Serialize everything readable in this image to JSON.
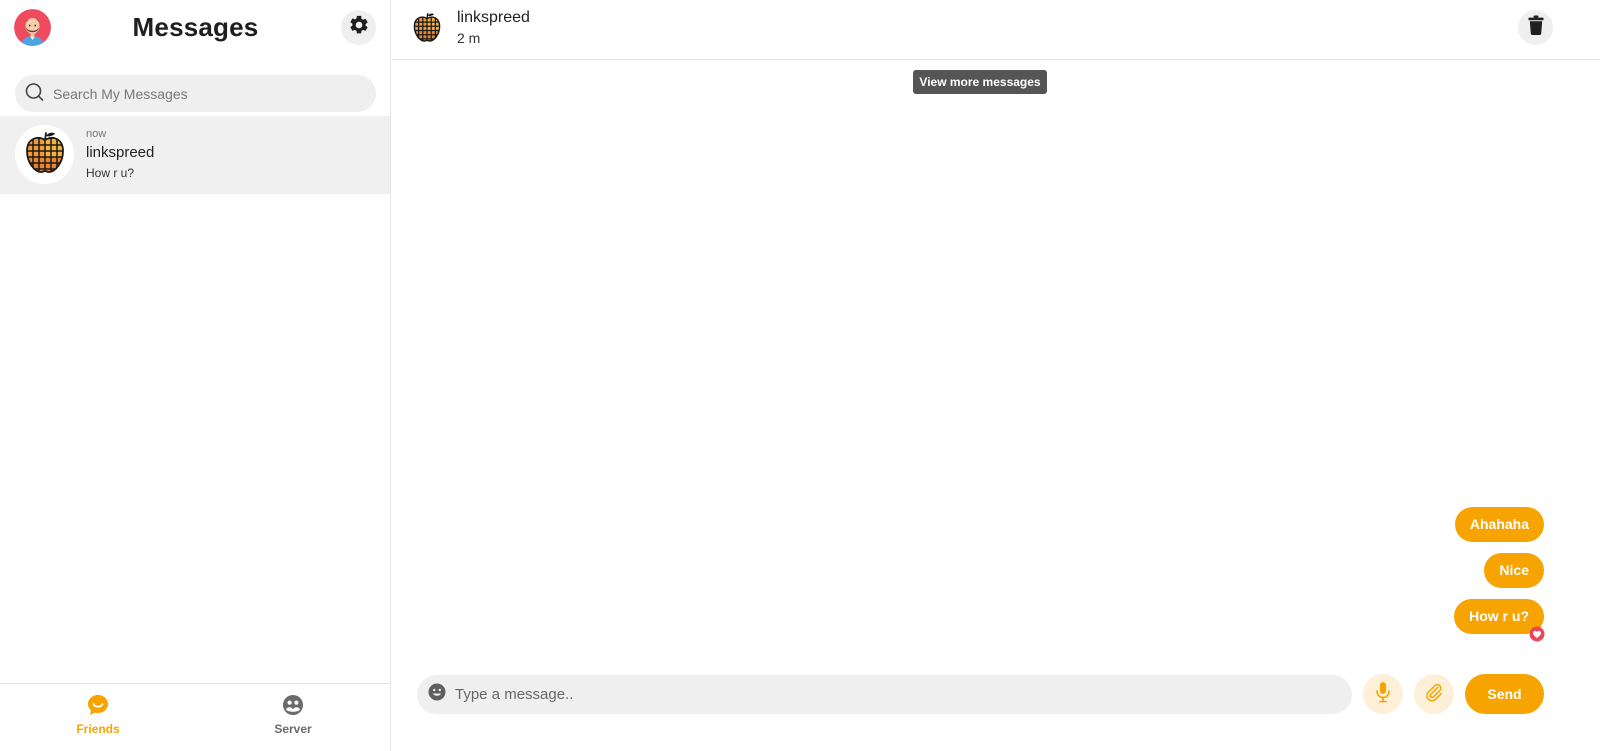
{
  "sidebar": {
    "title": "Messages",
    "search": {
      "placeholder": "Search My Messages",
      "value": ""
    },
    "conversations": [
      {
        "name": "linkspreed",
        "time": "now",
        "last_message": "How r u?",
        "avatar_icon": "apple-grid-icon"
      }
    ],
    "nav": [
      {
        "label": "Friends",
        "icon": "chat-bubble-smile-icon",
        "active": true
      },
      {
        "label": "Server",
        "icon": "globe-people-icon",
        "active": false
      }
    ]
  },
  "chat": {
    "contact_name": "linkspreed",
    "status": "2 m",
    "view_more_label": "View more messages",
    "messages": [
      {
        "text": "Ahahaha",
        "outgoing": true
      },
      {
        "text": "Nice",
        "outgoing": true
      },
      {
        "text": "How r u?",
        "outgoing": true,
        "reaction": "heart-icon"
      }
    ],
    "composer": {
      "placeholder": "Type a message..",
      "value": ""
    },
    "send_label": "Send"
  },
  "colors": {
    "accent": "#f7a400",
    "accent_light": "#fdf0d8",
    "panel_gray": "#efefef",
    "selected_row": "#f0f0f0",
    "heart": "#e8455b",
    "tooltip": "#555555"
  }
}
